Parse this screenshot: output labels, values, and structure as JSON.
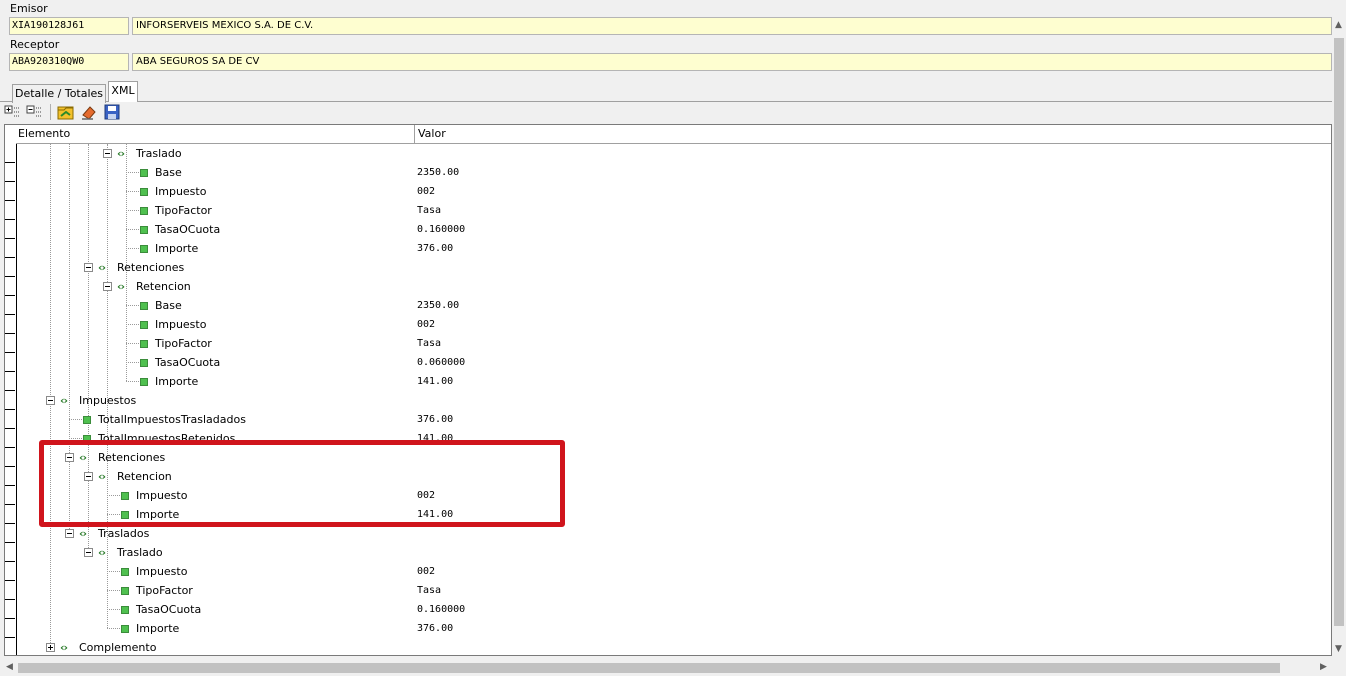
{
  "emisor": {
    "label": "Emisor",
    "rfc": "XIA190128J61",
    "name": "INFORSERVEIS MEXICO S.A. DE C.V."
  },
  "receptor": {
    "label": "Receptor",
    "rfc": "ABA920310QW0",
    "name": "ABA SEGUROS  SA DE CV"
  },
  "tabs": [
    {
      "label": "Detalle / Totales"
    },
    {
      "label": "XML"
    }
  ],
  "toolbar": {
    "icons": [
      "expand-all-icon",
      "collapse-all-icon",
      "open-folder-icon",
      "erase-icon",
      "save-icon"
    ]
  },
  "tree": {
    "headers": {
      "element": "Elemento",
      "value": "Valor"
    },
    "rows": [
      {
        "label": "Traslado",
        "value": "",
        "kind": "node",
        "expander": "minus"
      },
      {
        "label": "Base",
        "value": "2350.00",
        "kind": "leaf"
      },
      {
        "label": "Impuesto",
        "value": "002",
        "kind": "leaf"
      },
      {
        "label": "TipoFactor",
        "value": "Tasa",
        "kind": "leaf"
      },
      {
        "label": "TasaOCuota",
        "value": "0.160000",
        "kind": "leaf"
      },
      {
        "label": "Importe",
        "value": "376.00",
        "kind": "leaf"
      },
      {
        "label": "Retenciones",
        "value": "",
        "kind": "node",
        "expander": "minus"
      },
      {
        "label": "Retencion",
        "value": "",
        "kind": "node",
        "expander": "minus"
      },
      {
        "label": "Base",
        "value": "2350.00",
        "kind": "leaf"
      },
      {
        "label": "Impuesto",
        "value": "002",
        "kind": "leaf"
      },
      {
        "label": "TipoFactor",
        "value": "Tasa",
        "kind": "leaf"
      },
      {
        "label": "TasaOCuota",
        "value": "0.060000",
        "kind": "leaf"
      },
      {
        "label": "Importe",
        "value": "141.00",
        "kind": "leaf"
      },
      {
        "label": "Impuestos",
        "value": "",
        "kind": "node",
        "expander": "minus"
      },
      {
        "label": "TotalImpuestosTrasladados",
        "value": "376.00",
        "kind": "leaf"
      },
      {
        "label": "TotalImpuestosRetenidos",
        "value": "141.00",
        "kind": "leaf"
      },
      {
        "label": "Retenciones",
        "value": "",
        "kind": "node",
        "expander": "minus"
      },
      {
        "label": "Retencion",
        "value": "",
        "kind": "node",
        "expander": "minus"
      },
      {
        "label": "Impuesto",
        "value": "002",
        "kind": "leaf"
      },
      {
        "label": "Importe",
        "value": "141.00",
        "kind": "leaf"
      },
      {
        "label": "Traslados",
        "value": "",
        "kind": "node",
        "expander": "minus"
      },
      {
        "label": "Traslado",
        "value": "",
        "kind": "node",
        "expander": "minus"
      },
      {
        "label": "Impuesto",
        "value": "002",
        "kind": "leaf"
      },
      {
        "label": "TipoFactor",
        "value": "Tasa",
        "kind": "leaf"
      },
      {
        "label": "TasaOCuota",
        "value": "0.160000",
        "kind": "leaf"
      },
      {
        "label": "Importe",
        "value": "376.00",
        "kind": "leaf"
      },
      {
        "label": "Complemento",
        "value": "",
        "kind": "node",
        "expander": "plus"
      }
    ]
  },
  "colors": {
    "field_bg": "#fefed0",
    "leaf_icon": "#4fc04f",
    "highlight": "#d0141c"
  }
}
